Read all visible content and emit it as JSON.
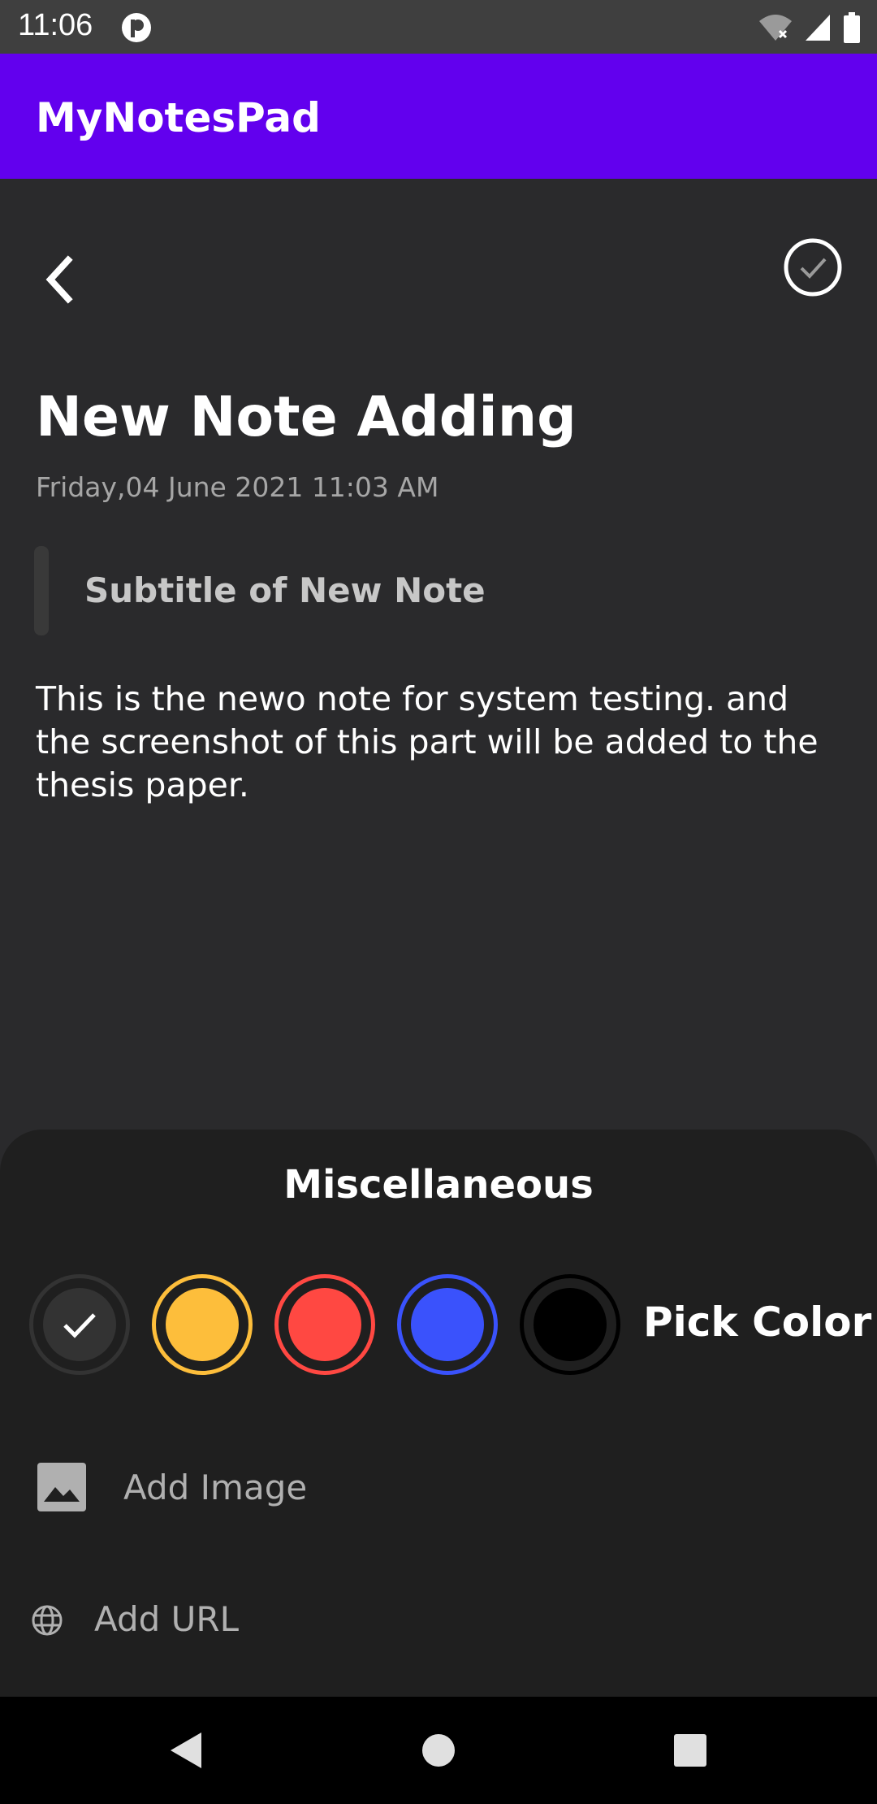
{
  "status_bar": {
    "time": "11:06",
    "icons": [
      "app-notification-icon",
      "wifi-icon",
      "signal-icon",
      "battery-icon"
    ]
  },
  "app_bar": {
    "title": "MyNotesPad",
    "color": "#6200ee"
  },
  "toolbar": {
    "back_icon": "back-icon",
    "save_icon": "checkmark-circle-icon"
  },
  "note": {
    "title": "New Note Adding",
    "datetime": "Friday,04 June 2021 11:03 AM",
    "subtitle": "Subtitle of New Note",
    "body": "This is the newo note for  system testing. and the screenshot of this part will be added to the thesis paper."
  },
  "misc_sheet": {
    "title": "Miscellaneous",
    "colors": [
      {
        "name": "default",
        "hex": "#333333",
        "selected": true
      },
      {
        "name": "yellow",
        "hex": "#fdbe3b",
        "selected": false
      },
      {
        "name": "red",
        "hex": "#ff4842",
        "selected": false
      },
      {
        "name": "blue",
        "hex": "#3a52fc",
        "selected": false
      },
      {
        "name": "black",
        "hex": "#000000",
        "selected": false
      }
    ],
    "pick_color_label": "Pick Color",
    "add_image_label": "Add Image",
    "add_url_label": "Add URL"
  },
  "nav_bar": {
    "buttons": [
      "back-triangle-icon",
      "home-circle-icon",
      "recents-square-icon"
    ]
  }
}
